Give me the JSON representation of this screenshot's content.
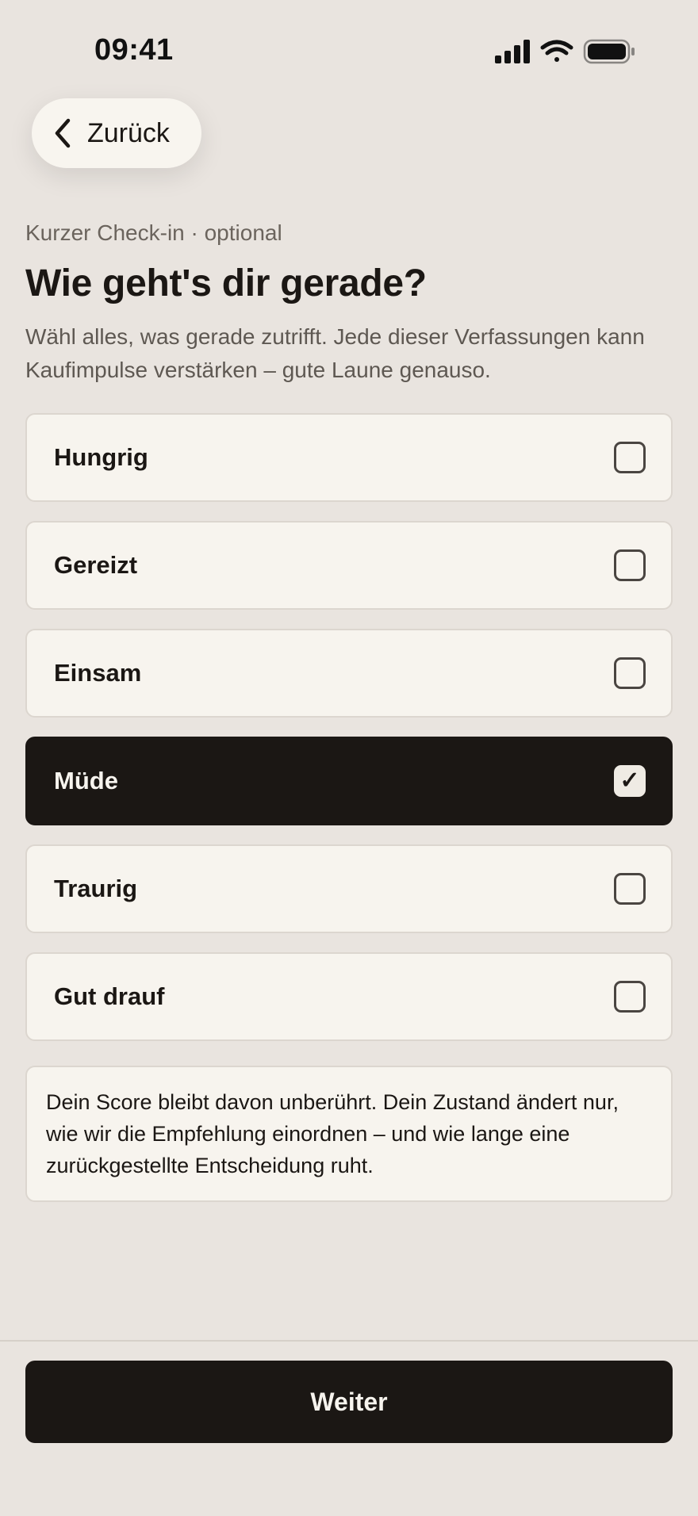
{
  "status_bar": {
    "time": "09:41",
    "icons": [
      "signal-icon",
      "wifi-icon",
      "battery-icon"
    ]
  },
  "header": {
    "back_label": "Zurück",
    "back_icon": "chevron-left-icon"
  },
  "main": {
    "eyebrow": "Kurzer Check-in · optional",
    "title": "Wie geht's dir gerade?",
    "subtitle": "Wähl alles, was gerade zutrifft. Jede dieser Verfassungen kann Kaufimpulse verstärken – gute Laune genauso.",
    "options": [
      {
        "label": "Hungrig",
        "checked": false
      },
      {
        "label": "Gereizt",
        "checked": false
      },
      {
        "label": "Einsam",
        "checked": false
      },
      {
        "label": "Müde",
        "checked": true,
        "check_mark": "✓"
      },
      {
        "label": "Traurig",
        "checked": false
      },
      {
        "label": "Gut drauf",
        "checked": false
      }
    ],
    "info_text": "Dein Score bleibt davon unberührt. Dein Zustand ändert nur, wie wir die Empfehlung einordnen – und wie lange eine zurückgestellte Entscheidung ruht."
  },
  "footer": {
    "continue_label": "Weiter"
  },
  "colors": {
    "background": "#e9e4df",
    "card": "#f7f4ee",
    "ink": "#1b1714",
    "muted": "#6b645d"
  }
}
